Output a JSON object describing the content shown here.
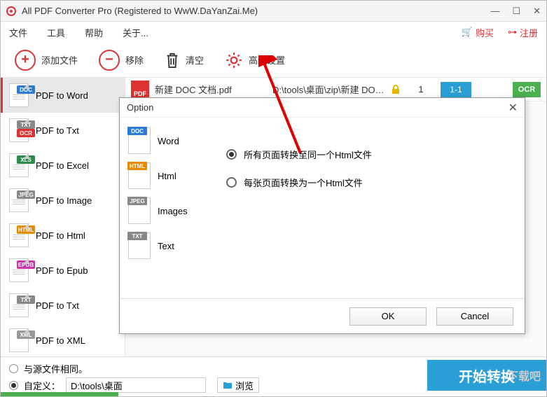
{
  "window": {
    "title": "All PDF Converter Pro (Registered to WwW.DaYanZai.Me)"
  },
  "menubar": {
    "file": "文件",
    "tools": "工具",
    "help": "帮助",
    "about": "关于...",
    "buy": "购买",
    "register": "注册"
  },
  "toolbar": {
    "add_file": "添加文件",
    "remove": "移除",
    "clear": "清空",
    "advanced": "高级设置"
  },
  "sidebar": {
    "items": [
      {
        "label": "PDF to Word"
      },
      {
        "label": "PDF to Txt"
      },
      {
        "label": "PDF to Excel"
      },
      {
        "label": "PDF to Image"
      },
      {
        "label": "PDF to Html"
      },
      {
        "label": "PDF to Epub"
      },
      {
        "label": "PDF to Txt"
      },
      {
        "label": "PDF to XML"
      }
    ]
  },
  "filelist": {
    "name": "新建 DOC 文档.pdf",
    "path": "D:\\tools\\桌面\\zip\\新建 DOC...",
    "pages": "1",
    "range": "1-1",
    "ocr": "OCR"
  },
  "output": {
    "same_as_source": "与源文件相同。",
    "custom": "自定义：",
    "path": "D:\\tools\\桌面",
    "browse": "浏览",
    "start": "开始转换"
  },
  "dialog": {
    "title": "Option",
    "tabs": {
      "word": "Word",
      "html": "Html",
      "images": "Images",
      "text": "Text"
    },
    "opt_single": "所有页面转换至同一个Html文件",
    "opt_multi": "每张页面转换为一个Html文件",
    "ok": "OK",
    "cancel": "Cancel"
  },
  "watermark": "下载吧"
}
